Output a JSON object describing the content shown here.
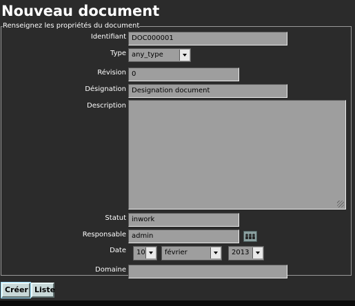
{
  "page": {
    "title": "Nouveau document"
  },
  "form": {
    "legend": "Renseignez les propriétés du document",
    "identifiant": {
      "label": "Identifiant",
      "value": "DOC000001"
    },
    "type": {
      "label": "Type",
      "value": "any_type"
    },
    "revision": {
      "label": "Révision",
      "value": "0"
    },
    "designation": {
      "label": "Désignation",
      "value": "Designation document"
    },
    "description": {
      "label": "Description",
      "value": ""
    },
    "statut": {
      "label": "Statut",
      "value": "inwork"
    },
    "responsable": {
      "label": "Responsable",
      "value": "admin",
      "picker_icon": "users-icon"
    },
    "date": {
      "label": "Date",
      "day": "10",
      "month": "février",
      "year": "2013"
    },
    "domaine": {
      "label": "Domaine",
      "value": ""
    }
  },
  "buttons": {
    "create": "Créer",
    "list": "Liste"
  }
}
